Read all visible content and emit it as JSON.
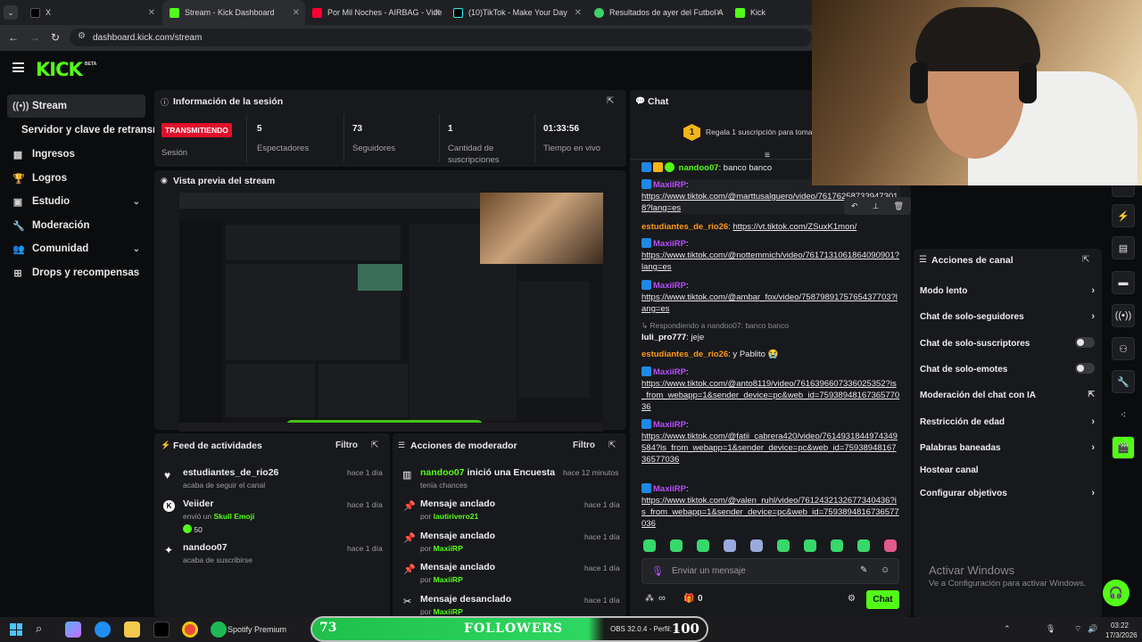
{
  "browser": {
    "tabs": [
      {
        "label": "X",
        "active": false
      },
      {
        "label": "Stream - Kick Dashboard",
        "active": true
      },
      {
        "label": "Por Mil Noches - AIRBAG - Vide",
        "active": false
      },
      {
        "label": "(10)TikTok - Make Your Day",
        "active": false
      },
      {
        "label": "Resultados de ayer del Futbol A",
        "active": false
      },
      {
        "label": "Kick",
        "active": false
      }
    ],
    "url": "dashboard.kick.com/stream"
  },
  "brand": {
    "logo": "KICK",
    "beta": "BETA",
    "accent": "#53fc18"
  },
  "sidebar": {
    "items": [
      {
        "label": "Stream",
        "icon": "stream-icon"
      },
      {
        "label": "Servidor y clave de retransm",
        "icon": ""
      },
      {
        "label": "Ingresos",
        "icon": "income-icon"
      },
      {
        "label": "Logros",
        "icon": "trophy-icon"
      },
      {
        "label": "Estudio",
        "icon": "studio-icon"
      },
      {
        "label": "Moderación",
        "icon": "wrench-icon"
      },
      {
        "label": "Comunidad",
        "icon": "community-icon"
      },
      {
        "label": "Drops y recompensas",
        "icon": "drops-icon"
      }
    ]
  },
  "session": {
    "title": "Información de la sesión",
    "status": "TRANSMITIENDO",
    "status_label": "Sesión",
    "viewers": "5",
    "viewers_label": "Espectadores",
    "followers": "73",
    "followers_label": "Seguidores",
    "subs": "1",
    "subs_label": "Cantidad de suscripciones",
    "uptime": "01:33:56",
    "uptime_label": "Tiempo en vivo"
  },
  "preview": {
    "title": "Vista previa del stream"
  },
  "feed": {
    "title": "Feed de actividades",
    "filter": "Filtro",
    "items": [
      {
        "name": "estudiantes_de_rio26",
        "sub": "acaba de seguir el canal",
        "time": "hace 1 día",
        "icon": "heart-icon"
      },
      {
        "name": "Veiider",
        "sub_prefix": "envió un",
        "sub_highlight": "Skull Emoji",
        "amount": "50",
        "time": "hace 1 día",
        "icon": "kick-coin-icon"
      },
      {
        "name": "nandoo07",
        "sub": "acaba de suscribirse",
        "time": "hace 1 día",
        "icon": "star-icon"
      }
    ]
  },
  "modactions": {
    "title": "Acciones de moderador",
    "filter": "Filtro",
    "items": [
      {
        "user": "nandoo07",
        "action": "inició una Encuesta",
        "sub": "tenía chances",
        "time": "hace 12 minutos",
        "icon": "poll-icon"
      },
      {
        "action": "Mensaje anclado",
        "by_prefix": "por",
        "by": "lautirivero21",
        "time": "hace 1 día",
        "icon": "pin-icon"
      },
      {
        "action": "Mensaje anclado",
        "by_prefix": "por",
        "by": "MaxiiRP",
        "time": "hace 1 día",
        "icon": "pin-icon"
      },
      {
        "action": "Mensaje anclado",
        "by_prefix": "por",
        "by": "MaxiiRP",
        "time": "hace 1 día",
        "icon": "pin-icon"
      },
      {
        "action": "Mensaje desanclado",
        "by_prefix": "por",
        "by": "MaxiiRP",
        "time": "hace 1 día",
        "icon": "unpin-icon"
      }
    ]
  },
  "chat": {
    "title": "Chat",
    "gift_count": "1",
    "gift_text": "Regala 1 suscripción para toma",
    "messages": [
      {
        "user": "nandoo07",
        "color": "#53fc18",
        "text": ": banco banco"
      },
      {
        "user": "MaxiiRP",
        "color": "#b84dff",
        "text": ":",
        "link": "https://www.tiktok.com/@marttusalguero/video/761762587339473018?lang=es"
      },
      {
        "user": "estudiantes_de_rio26",
        "color": "#ff9a1f",
        "text": ":",
        "link": "https://vt.tiktok.com/ZSuxK1mon/"
      },
      {
        "user": "MaxiiRP",
        "color": "#b84dff",
        "text": ":",
        "link": "https://www.tiktok.com/@nottemmich/video/7617131061864090901?lang=es"
      },
      {
        "user": "MaxiiRP",
        "color": "#b84dff",
        "text": ":",
        "link": "https://www.tiktok.com/@ambar_fox/video/7587989175765437703?lang=es"
      },
      {
        "reply": "Respondiendo a nandoo07: banco banco",
        "user": "luli_pro777",
        "color": "#ffffff",
        "text": ": jeje"
      },
      {
        "user": "estudiantes_de_rio26",
        "color": "#ff9a1f",
        "text": ": y Pablito 😭"
      },
      {
        "user": "MaxiiRP",
        "color": "#b84dff",
        "text": ":",
        "link": "https://www.tiktok.com/@anto8119/video/7616396607336025352?is_from_webapp=1&sender_device=pc&web_id=7593894816736577036"
      },
      {
        "user": "MaxiiRP",
        "color": "#b84dff",
        "text": ":",
        "link": "https://www.tiktok.com/@fatii_cabrera420/video/7614931844974349584?is_from_webapp=1&sender_device=pc&web_id=7593894816736577036"
      },
      {
        "user": "MaxiiRP",
        "color": "#b84dff",
        "text": ":",
        "link": "https://www.tiktok.com/@valen_ruhl/video/7612432132677340436?is_from_webapp=1&sender_device=pc&web_id=7593894816736577036"
      }
    ],
    "input_placeholder": "Enviar un mensaje",
    "points": "∞",
    "gifts_count": "0",
    "send_label": "Chat"
  },
  "actions": {
    "title": "Acciones de canal",
    "items": [
      {
        "label": "Modo lento",
        "control": "arrow"
      },
      {
        "label": "Chat de solo-seguidores",
        "control": "arrow"
      },
      {
        "label": "Chat de solo-suscriptores",
        "control": "toggle"
      },
      {
        "label": "Chat de solo-emotes",
        "control": "toggle"
      },
      {
        "label": "Moderación del chat con IA",
        "control": "external"
      },
      {
        "label": "Restricción de edad",
        "control": "arrow"
      },
      {
        "label": "Palabras baneadas",
        "control": "arrow"
      },
      {
        "label": "Hostear canal",
        "control": "none"
      },
      {
        "label": "Configurar objetivos",
        "control": "arrow"
      }
    ]
  },
  "windows_watermark": {
    "line1": "Activar Windows",
    "line2": "Ve a Configuración para activar Windows."
  },
  "overlay": {
    "followers_count": "73",
    "followers_label": "FOLLOWERS",
    "followers_goal": "100"
  },
  "taskbar": {
    "spotify": "Spotify Premium",
    "obs": "OBS 32.0.4 - Perfil: ...",
    "time": "03:22",
    "date": "17/3/2026"
  }
}
